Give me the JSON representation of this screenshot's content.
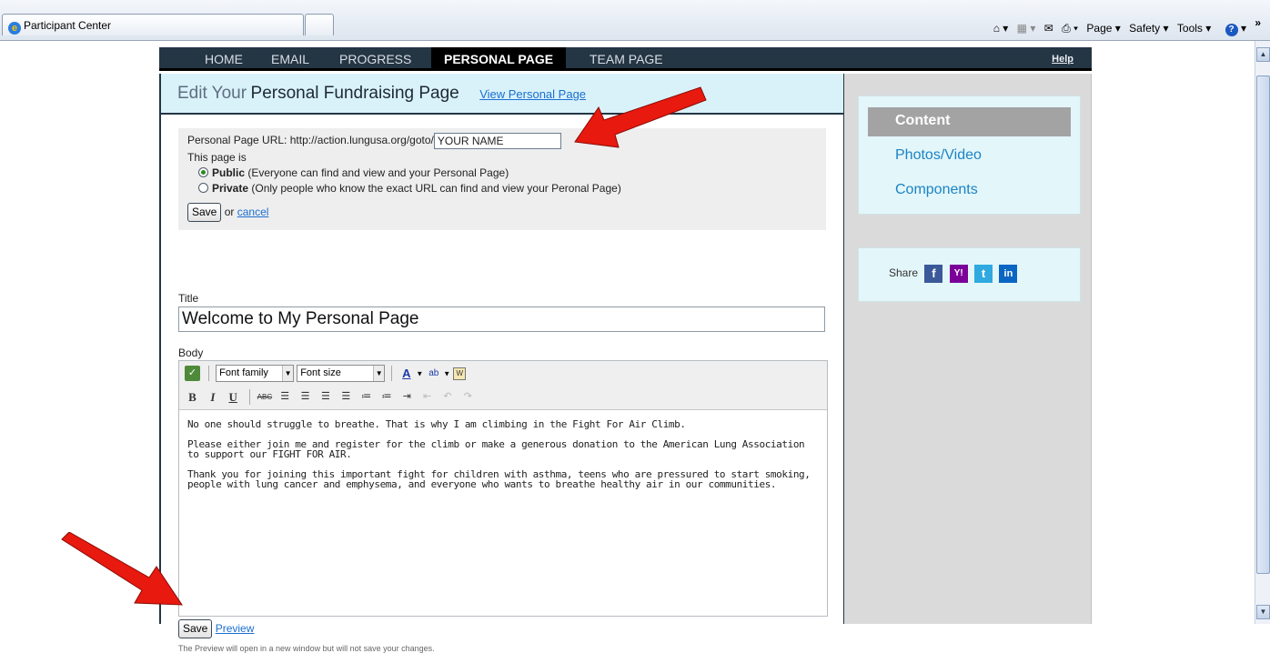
{
  "browser": {
    "tab_title": "Participant Center",
    "commands": [
      "Page",
      "Safety",
      "Tools"
    ]
  },
  "nav": {
    "items": [
      "HOME",
      "EMAIL",
      "PROGRESS",
      "PERSONAL PAGE",
      "TEAM PAGE"
    ],
    "help": "Help"
  },
  "header": {
    "title_prefix": "Edit Your",
    "title_main": "Personal Fundraising Page",
    "view_link": "View Personal Page"
  },
  "url_box": {
    "label": "Personal Page URL:",
    "url_prefix": "http://action.lungusa.org/goto/",
    "url_value": "YOUR NAME",
    "page_is": "This page is",
    "public_label": "Public",
    "public_desc": "(Everyone can find and view and your Personal Page)",
    "private_label": "Private",
    "private_desc": "(Only people who know the exact URL can find and view your Peronal Page)",
    "save": "Save",
    "or": "or",
    "cancel": "cancel"
  },
  "form": {
    "title_label": "Title",
    "title_value": "Welcome to My Personal Page",
    "body_label": "Body",
    "font_family": "Font family",
    "font_size": "Font size",
    "body_paragraphs": [
      "No one should struggle to breathe. That is why I am climbing in the Fight For Air Climb.",
      "Please either join me and register for the climb or make a generous donation to the American Lung Association to support our FIGHT FOR AIR.",
      "Thank you for joining this important fight for children with asthma, teens who are pressured to start smoking, people with lung cancer and emphysema, and everyone who wants to breathe healthy air in our communities."
    ],
    "save": "Save",
    "preview": "Preview",
    "preview_note": "The Preview will open in a new window but will not save your changes."
  },
  "sidebar": {
    "items": [
      "Content",
      "Photos/Video",
      "Components"
    ],
    "share_label": "Share"
  },
  "colors": {
    "nav_bg": "#243544",
    "title_bg": "#d9f2f9",
    "sidebar_bg": "#dadada",
    "link": "#1b6fd1",
    "annotation_arrow": "#e8190f"
  }
}
